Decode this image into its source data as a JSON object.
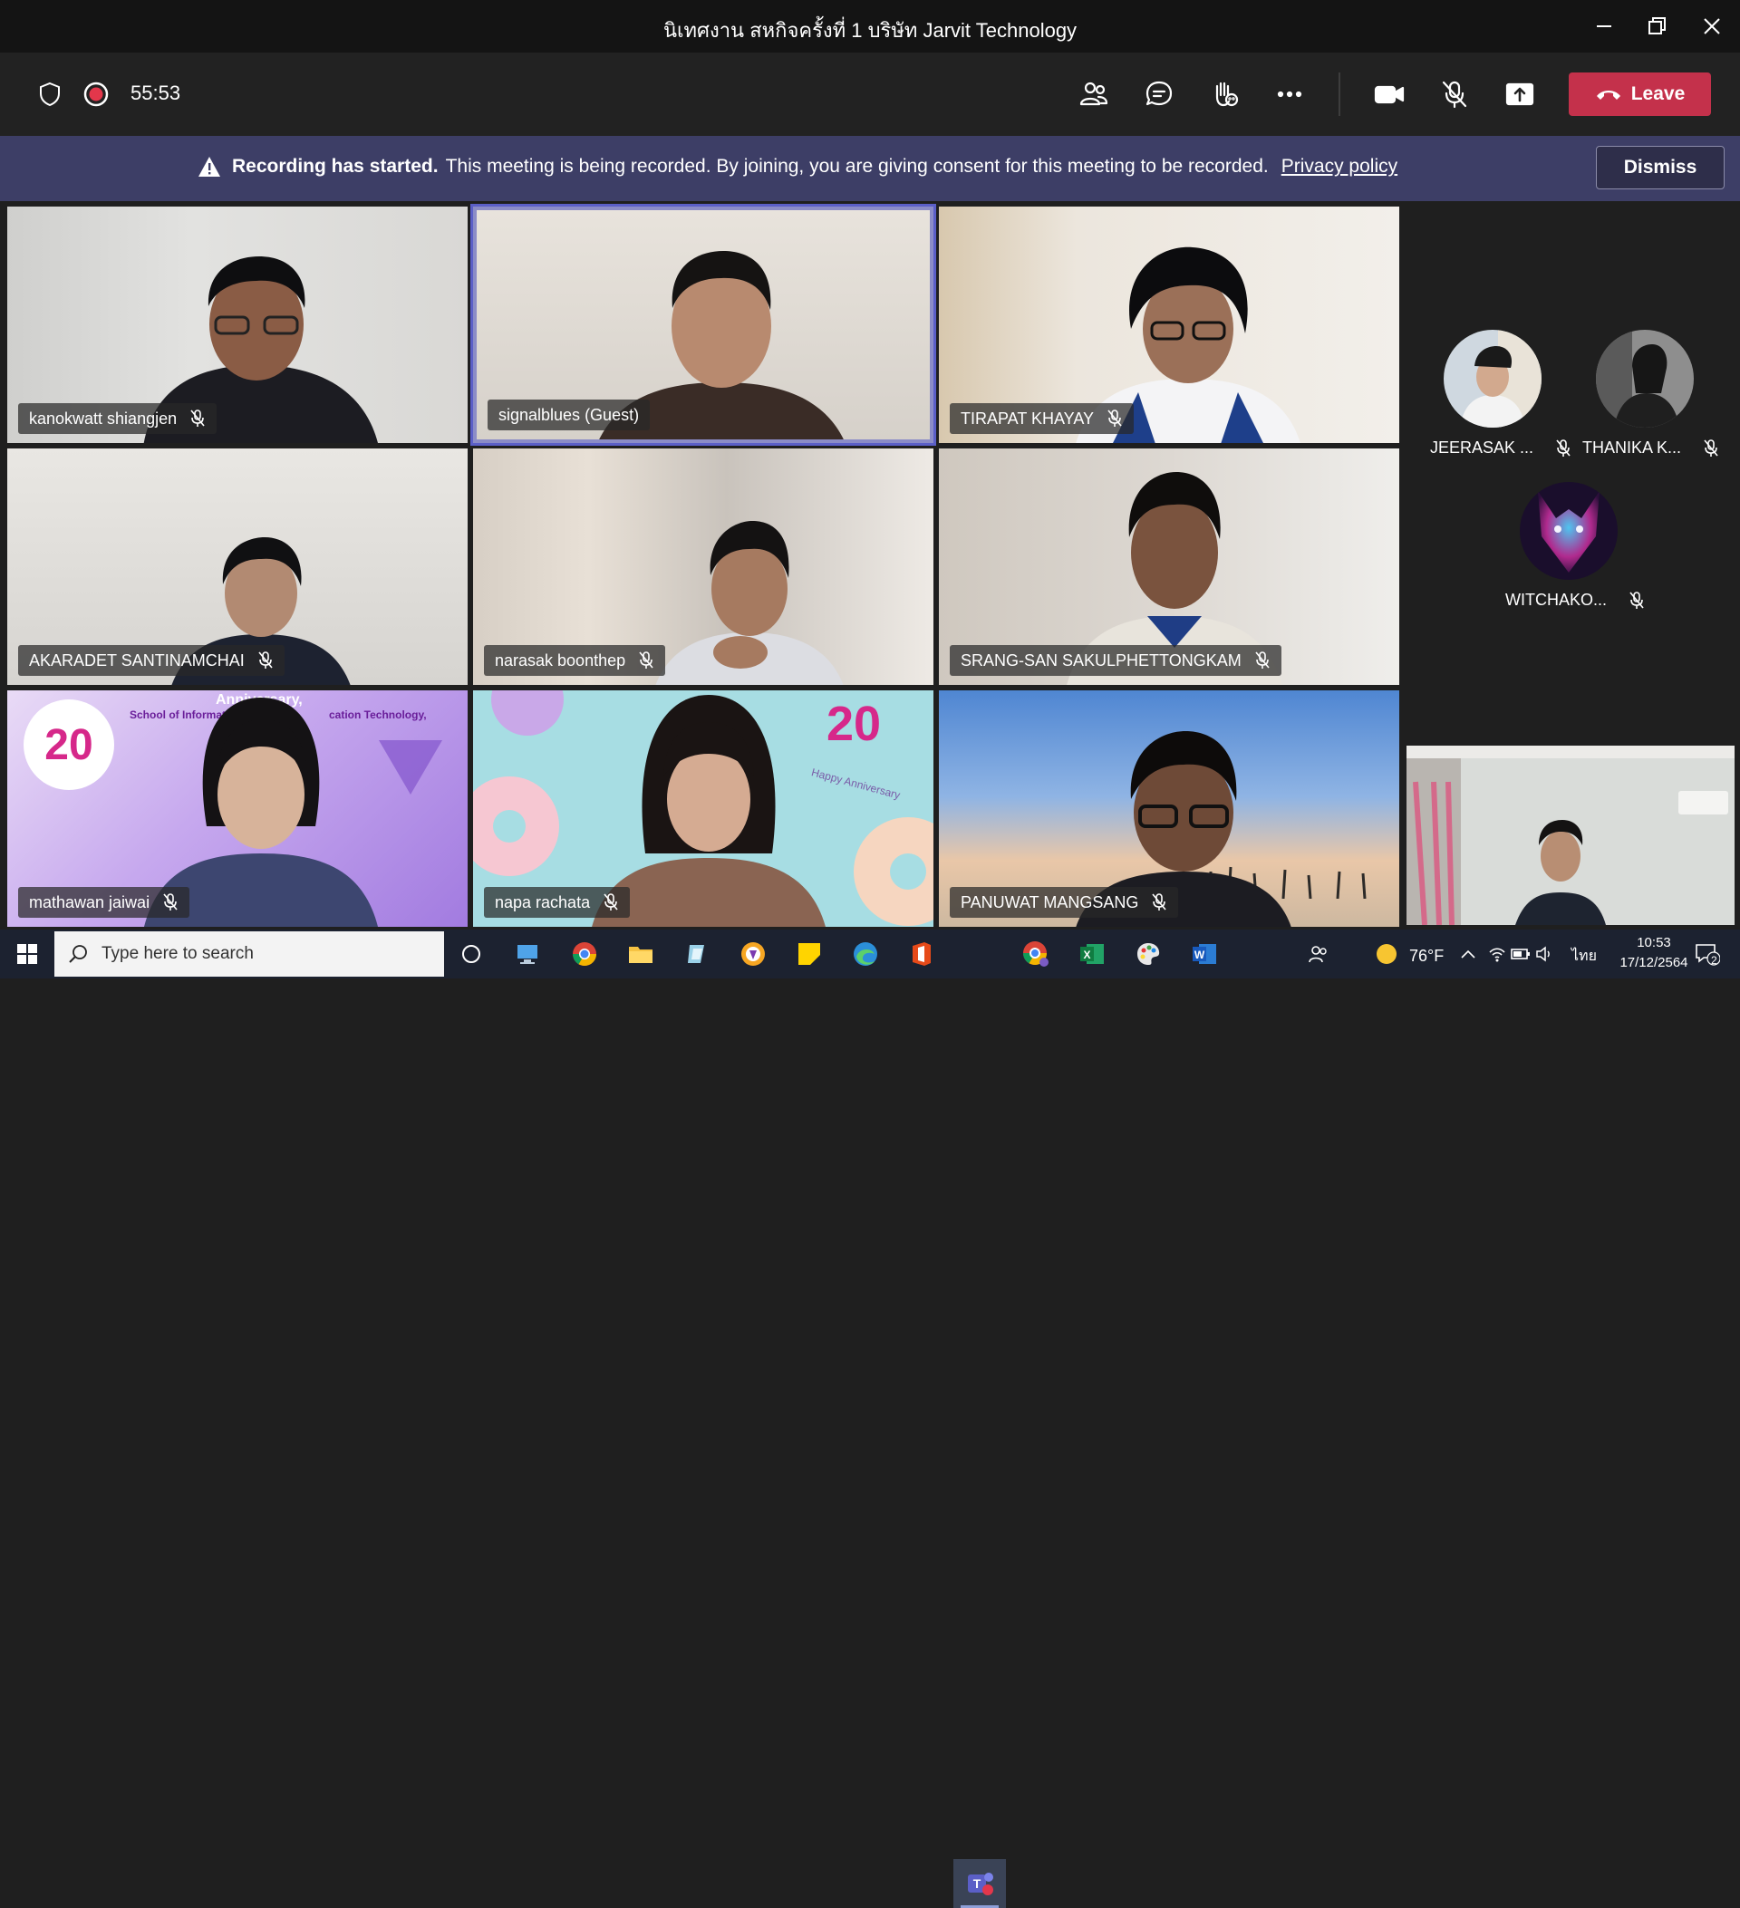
{
  "window": {
    "title": "นิเทศงาน สหกิจครั้งที่ 1 บริษัท Jarvit Technology"
  },
  "toolbar": {
    "timer": "55:53",
    "leave_label": "Leave"
  },
  "banner": {
    "bold_text": "Recording has started.",
    "message": "This meeting is being recorded. By joining, you are giving consent for this meeting to be recorded.",
    "link_text": "Privacy policy",
    "dismiss_label": "Dismiss"
  },
  "participants": [
    {
      "name": "kanokwatt shiangjen"
    },
    {
      "name": "signalblues (Guest)"
    },
    {
      "name": "TIRAPAT KHAYAY"
    },
    {
      "name": "AKARADET SANTINAMCHAI"
    },
    {
      "name": "narasak boonthep"
    },
    {
      "name": "SRANG-SAN SAKULPHETTONGKAM"
    },
    {
      "name": "mathawan jaiwai"
    },
    {
      "name": "napa rachata"
    },
    {
      "name": "PANUWAT MANGSANG"
    }
  ],
  "roster": [
    {
      "name": "JEERASAK ..."
    },
    {
      "name": "THANIKA K..."
    },
    {
      "name": "WITCHAKO..."
    }
  ],
  "backgrounds": {
    "tile7_line1": "20",
    "tile7_line2": "Anniversary,",
    "tile7_line3": "School of Informati",
    "tile7_line4": "cation Technology,",
    "tile8_line1": "20",
    "tile8_line2": "Happy Anniversary"
  },
  "taskbar": {
    "search_placeholder": "Type here to search",
    "weather": "76°F",
    "language": "ไทย",
    "time": "10:53",
    "date": "17/12/2564",
    "notification_count": "2"
  },
  "colors": {
    "leave": "#c4314b",
    "banner": "#3d3e66",
    "active_border": "#8b8cc7",
    "recording": "#e3374b"
  }
}
